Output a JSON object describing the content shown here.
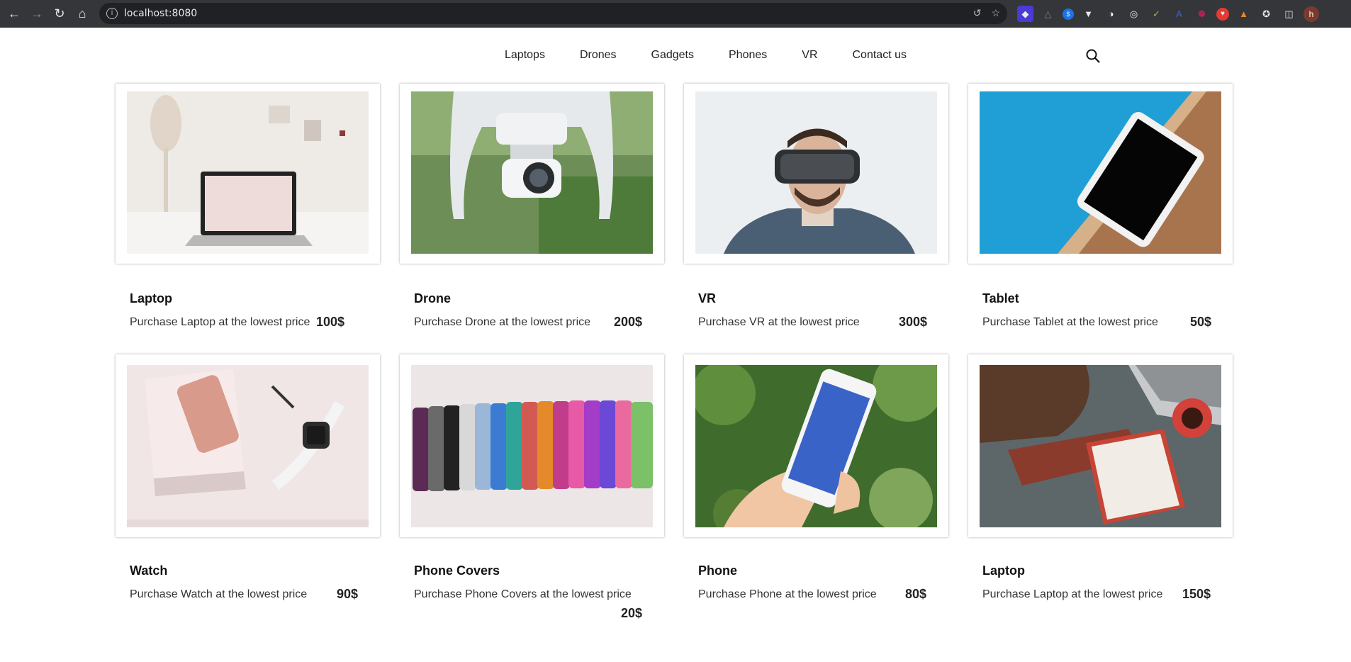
{
  "browser": {
    "url": "localhost:8080",
    "icons": [
      "back-icon",
      "forward-icon",
      "reload-icon",
      "home-icon",
      "info-icon",
      "share-icon",
      "bookmark-star-icon",
      "puzzle-icon",
      "sidebar-icon"
    ],
    "profile_initial": "h"
  },
  "nav": {
    "items": [
      "Laptops",
      "Drones",
      "Gadgets",
      "Phones",
      "VR",
      "Contact us"
    ],
    "search_icon": "search-icon"
  },
  "products": [
    {
      "title": "Laptop",
      "description": "Purchase Laptop at the lowest price",
      "price": "100$",
      "image": "laptop-on-desk"
    },
    {
      "title": "Drone",
      "description": "Purchase Drone at the lowest price",
      "price": "200$",
      "image": "drone-camera"
    },
    {
      "title": "VR",
      "description": "Purchase VR at the lowest price",
      "price": "300$",
      "image": "man-with-vr-headset"
    },
    {
      "title": "Tablet",
      "description": "Purchase Tablet at the lowest price",
      "price": "50$",
      "image": "tablet-by-pool"
    },
    {
      "title": "Watch",
      "description": "Purchase Watch at the lowest price",
      "price": "90$",
      "image": "watch-and-phone-on-notebook"
    },
    {
      "title": "Phone Covers",
      "description": "Purchase Phone Covers at the lowest price",
      "price": "20$",
      "image": "row-of-phone-covers"
    },
    {
      "title": "Phone",
      "description": "Purchase Phone at the lowest price",
      "price": "80$",
      "image": "hand-holding-phone"
    },
    {
      "title": "Laptop",
      "description": "Purchase Laptop at the lowest price",
      "price": "150$",
      "image": "laptop-notebook-coffee"
    }
  ]
}
